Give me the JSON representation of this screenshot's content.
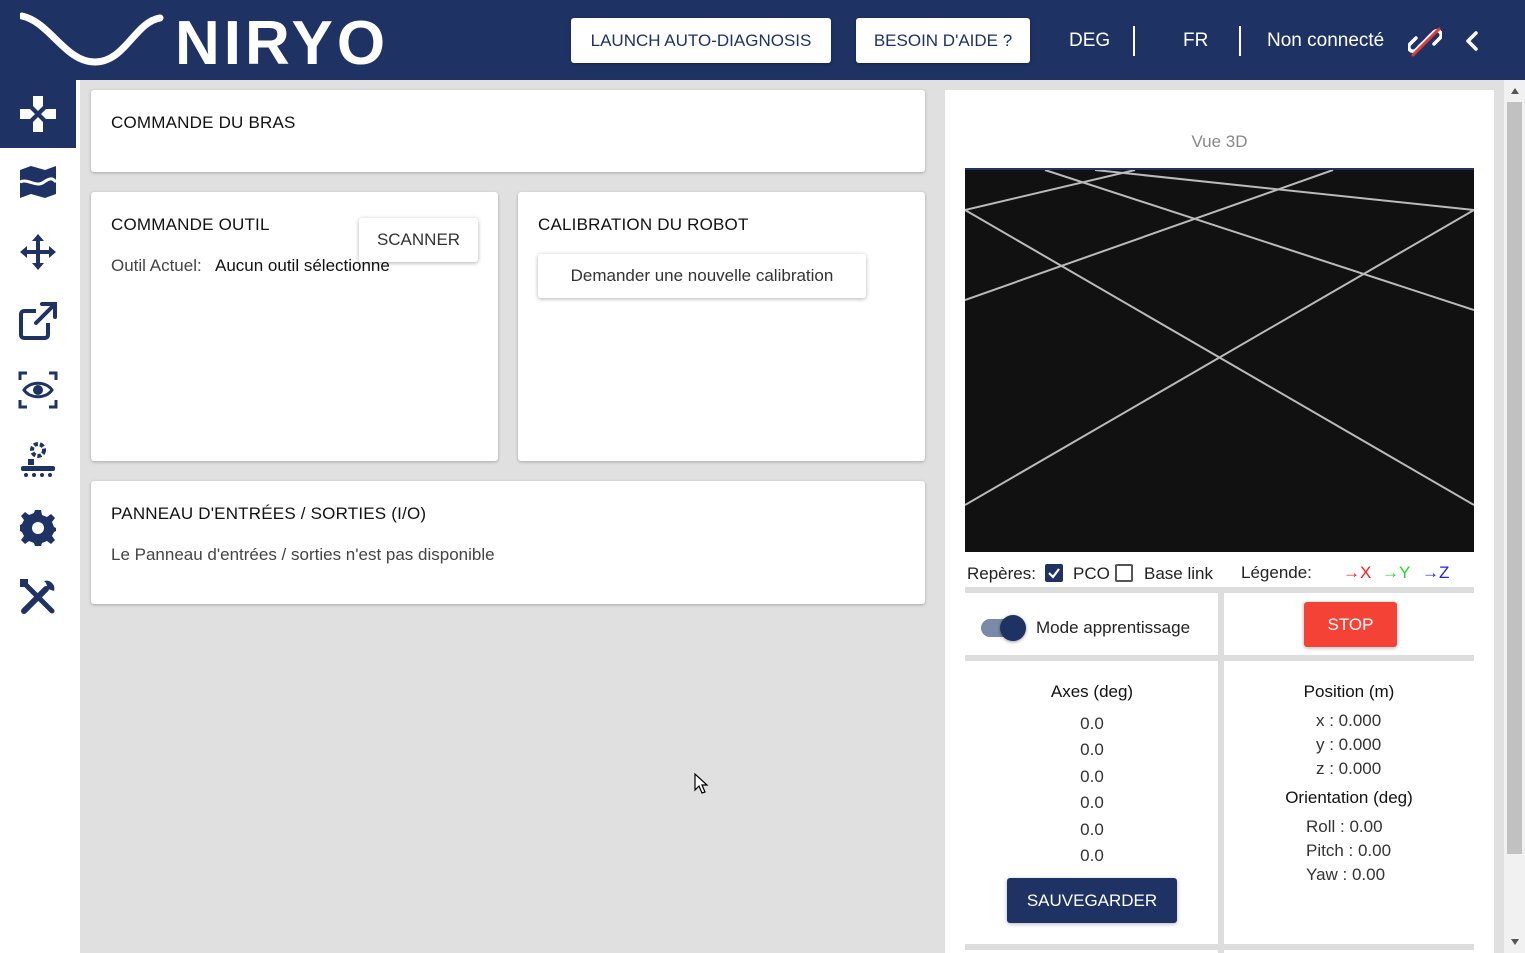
{
  "header": {
    "logo_text": "NIRYO",
    "diagnosis_label": "LAUNCH AUTO-DIAGNOSIS",
    "help_label": "BESOIN D'AIDE ?",
    "unit_label": "DEG",
    "lang_label": "FR",
    "separator": "|",
    "connection_label": "Non connecté",
    "connection_icon": "unlink-icon",
    "collapse_icon": "chevron-left-icon"
  },
  "sidebar": {
    "items": [
      {
        "icon": "gamepad-icon",
        "active": true
      },
      {
        "icon": "map-icon",
        "active": false
      },
      {
        "icon": "move-arrows-icon",
        "active": false
      },
      {
        "icon": "external-link-icon",
        "active": false
      },
      {
        "icon": "eye-icon",
        "active": false
      },
      {
        "icon": "conveyor-icon",
        "active": false
      },
      {
        "icon": "gear-icon",
        "active": false
      },
      {
        "icon": "tools-icon",
        "active": false
      }
    ]
  },
  "arm_card": {
    "title": "COMMANDE DU BRAS"
  },
  "tool_card": {
    "title": "COMMANDE OUTIL",
    "scan_label": "SCANNER",
    "current_label": "Outil Actuel:",
    "current_value": "Aucun outil sélectionné"
  },
  "calibration_card": {
    "title": "CALIBRATION DU ROBOT",
    "button_label": "Demander une nouvelle calibration"
  },
  "io_card": {
    "title": "PANNEAU D'ENTRÉES / SORTIES (I/O)",
    "message": "Le Panneau d'entrées / sorties n'est pas disponible"
  },
  "viewer": {
    "title": "Vue 3D",
    "reperes_label": "Repères:",
    "pco_label": "PCO",
    "pco_checked": true,
    "base_link_label": "Base link",
    "base_link_checked": false,
    "legend_label": "Légende:",
    "legend": [
      {
        "axis": "X",
        "color": "#ff1a1a"
      },
      {
        "axis": "Y",
        "color": "#22dd22"
      },
      {
        "axis": "Z",
        "color": "#2222ee"
      }
    ]
  },
  "controls": {
    "learning_mode_label": "Mode apprentissage",
    "learning_mode_on": true,
    "stop_label": "STOP"
  },
  "joints": {
    "title": "Axes (deg)",
    "values": [
      "0.0",
      "0.0",
      "0.0",
      "0.0",
      "0.0",
      "0.0"
    ],
    "save_label": "SAUVEGARDER"
  },
  "pose": {
    "position_title": "Position (m)",
    "x": "x : 0.000",
    "y": "y : 0.000",
    "z": "z : 0.000",
    "orientation_title": "Orientation (deg)",
    "roll": "Roll : 0.00",
    "pitch": "Pitch : 0.00",
    "yaw": "Yaw : 0.00"
  },
  "colors": {
    "brand": "#1e3263",
    "stop": "#f44336",
    "background": "#e0e0e0"
  }
}
